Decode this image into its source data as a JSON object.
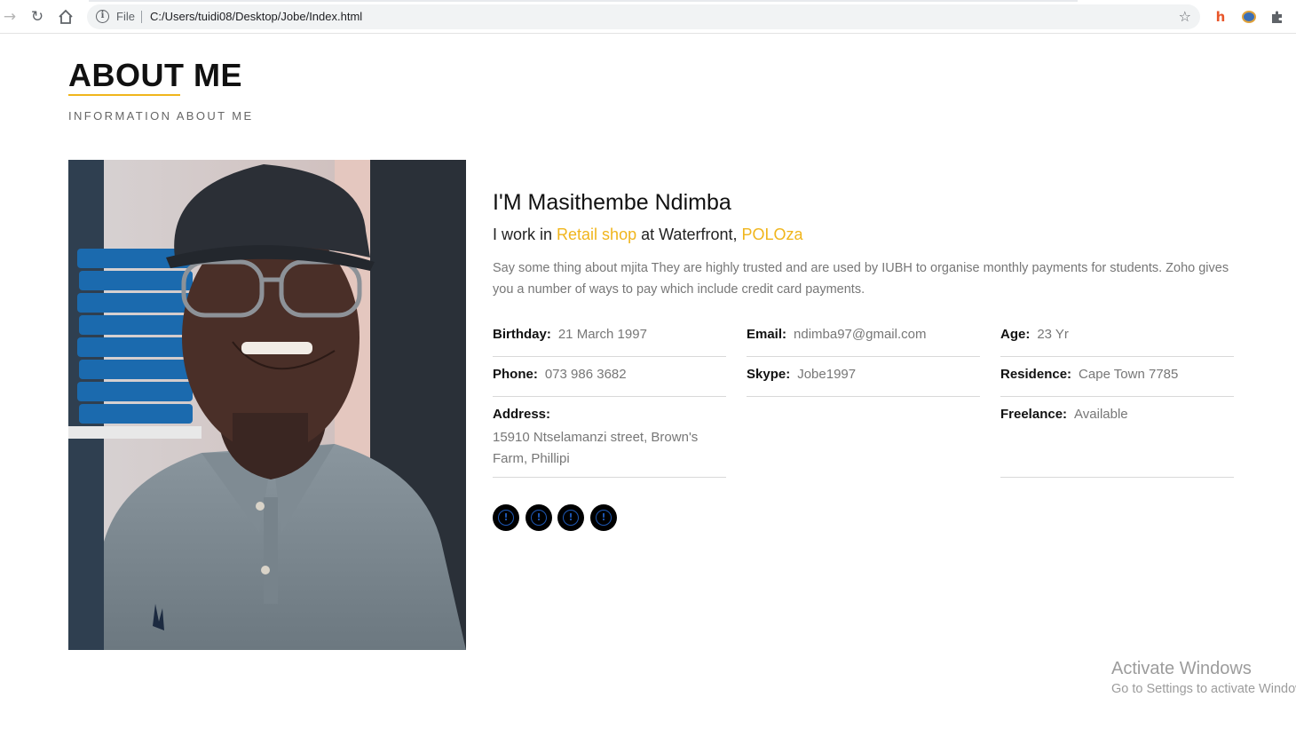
{
  "browser": {
    "scheme_label": "File",
    "url": "C:/Users/tuidi08/Desktop/Jobe/Index.html",
    "icons": [
      "back-arrow-icon",
      "reload-icon",
      "home-icon",
      "info-icon",
      "bookmark-star-icon",
      "extension-icon",
      "profile-extension-icon",
      "puzzle-extensions-icon"
    ]
  },
  "about": {
    "title": "ABOUT ME",
    "subtitle": "INFORMATION ABOUT ME",
    "accent_color": "#f0b51c"
  },
  "profile": {
    "name": "I'M Masithembe Ndimba",
    "work_prefix": "I work in ",
    "work_place": "Retail shop",
    "work_middle": " at Waterfront, ",
    "work_company": "POLOza",
    "bio": "Say some thing about mjita They are highly trusted and are used by IUBH to organise monthly payments for students. Zoho gives you a number of ways to pay which include credit card payments."
  },
  "details": {
    "birthday": {
      "label": "Birthday:",
      "value": "21 March 1997"
    },
    "email": {
      "label": "Email:",
      "value": "ndimba97@gmail.com"
    },
    "age": {
      "label": "Age:",
      "value": "23 Yr"
    },
    "phone": {
      "label": "Phone:",
      "value": "073 986 3682"
    },
    "skype": {
      "label": "Skype:",
      "value": "Jobe1997"
    },
    "residence": {
      "label": "Residence:",
      "value": "Cape Town 7785"
    },
    "address": {
      "label": "Address:",
      "value": "15910 Ntselamanzi street, Brown's Farm, Phillipi"
    },
    "freelance": {
      "label": "Freelance:",
      "value": "Available"
    }
  },
  "social": [
    {
      "icon": "social-link-icon",
      "glyph": "!"
    },
    {
      "icon": "social-link-icon",
      "glyph": "!"
    },
    {
      "icon": "social-link-icon",
      "glyph": "!"
    },
    {
      "icon": "social-link-icon",
      "glyph": "!"
    }
  ],
  "watermark": {
    "line1": "Activate Windows",
    "line2": "Go to Settings to activate Windows."
  }
}
